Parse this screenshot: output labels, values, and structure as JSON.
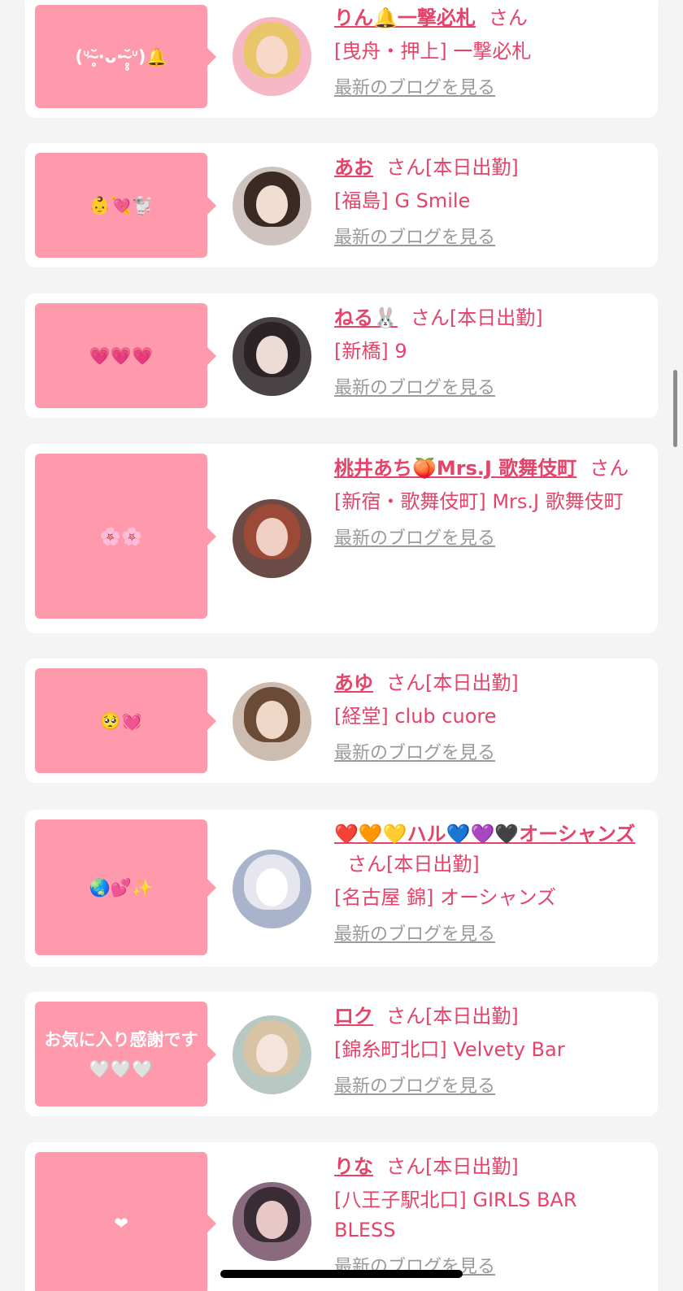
{
  "entries": [
    {
      "message": "(ᐡ˘̴̥̥·ᴗ·˘̴̥̥ᐡ)🔔",
      "name": "りん🔔一撃必札",
      "san_label": "さん",
      "shop": "[曳舟・押上] 一撃必札",
      "blog_link": "最新のブログを見る",
      "avatar": {
        "hair": "#e9c66a",
        "face": "#f6d9c9",
        "bg": "#f6b8c6"
      }
    },
    {
      "message": "👶💘🐩",
      "name": "あお",
      "san_label": "さん[本日出勤]",
      "shop": "[福島] G Smile",
      "blog_link": "最新のブログを見る",
      "avatar": {
        "hair": "#3b2a24",
        "face": "#f1ddd2",
        "bg": "#cfc3bf"
      }
    },
    {
      "message": "💗💗💗",
      "name": "ねる🐰",
      "san_label": "さん[本日出勤]",
      "shop": "[新橋] 9",
      "blog_link": "最新のブログを見る",
      "avatar": {
        "hair": "#2b2325",
        "face": "#eddcd6",
        "bg": "#4a4346"
      }
    },
    {
      "message": "🌸🌸",
      "name": "桃井あち🍑Mrs.J 歌舞伎町",
      "san_label": "さん",
      "shop": "[新宿・歌舞伎町] Mrs.J 歌舞伎町",
      "blog_link": "最新のブログを見る",
      "avatar": {
        "hair": "#9b4a38",
        "face": "#f0cfc4",
        "bg": "#6b4b46"
      }
    },
    {
      "message": "🥺💓",
      "name": "あゆ",
      "san_label": "さん[本日出勤]",
      "shop": "[経堂] club cuore",
      "blog_link": "最新のブログを見る",
      "avatar": {
        "hair": "#6b4a36",
        "face": "#f0d8c8",
        "bg": "#cdbdb1"
      }
    },
    {
      "message": "🌏💕✨",
      "name": "❤️🧡💛ハル💙💜🖤オーシャンズ",
      "san_label": "さん[本日出勤]",
      "shop": "[名古屋 錦] オーシャンズ",
      "blog_link": "最新のブログを見る",
      "avatar": {
        "hair": "#e6e6ee",
        "face": "#ffffff",
        "bg": "#a9b4cc"
      }
    },
    {
      "message": "お気に入り感謝です🤍🤍🤍",
      "name": "ロク",
      "san_label": "さん[本日出勤]",
      "shop": "[錦糸町北口] Velvety Bar",
      "blog_link": "最新のブログを見る",
      "avatar": {
        "hair": "#d8c4a4",
        "face": "#f4e4da",
        "bg": "#b7c7c2"
      }
    },
    {
      "message": "❤",
      "name": "りな",
      "san_label": "さん[本日出勤]",
      "shop": "[八王子駅北口] GIRLS BAR BLESS",
      "blog_link": "最新のブログを見る",
      "avatar": {
        "hair": "#3a2c34",
        "face": "#e7c8c6",
        "bg": "#8a6a7e"
      }
    }
  ],
  "colors": {
    "accent": "#e4436a",
    "bubble": "#fe9aab",
    "link_gray": "#9a9a9a",
    "background": "#f4f4f4"
  }
}
